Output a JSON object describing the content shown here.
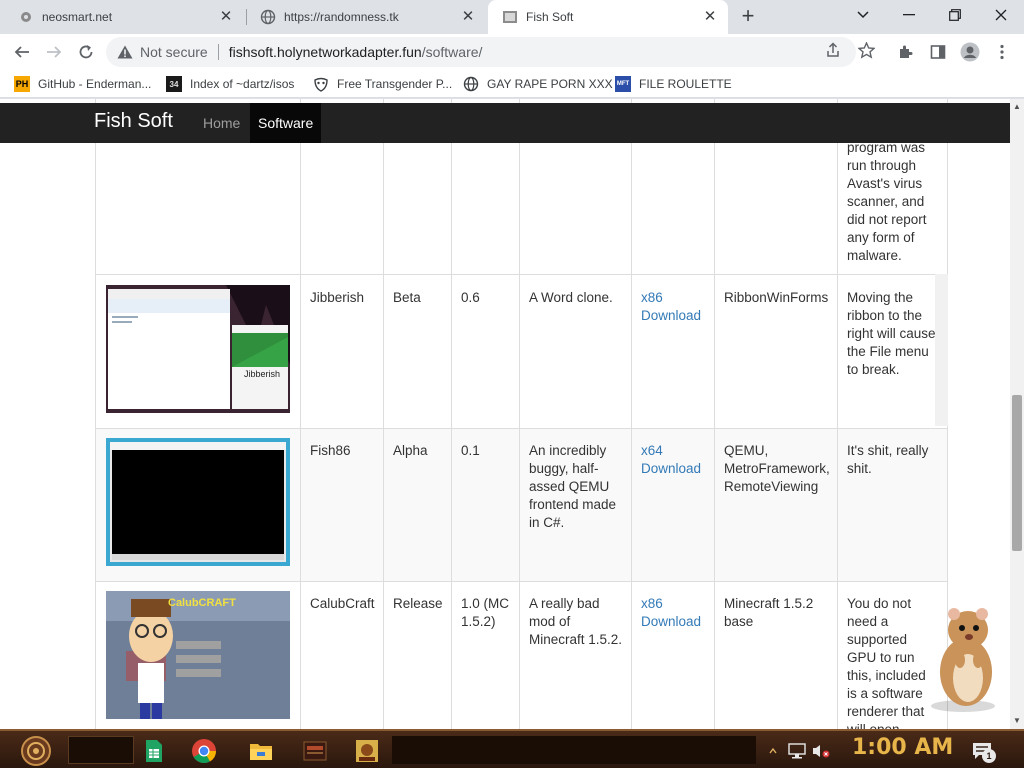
{
  "browser": {
    "tabs": [
      {
        "title": "neosmart.net",
        "icon": "gear-favicon"
      },
      {
        "title": "https://randomness.tk",
        "icon": "globe-icon"
      },
      {
        "title": "Fish Soft",
        "icon": "page-favicon",
        "active": true
      }
    ],
    "address": {
      "security_label": "Not secure",
      "host": "fishsoft.holynetworkadapter.fun",
      "path": "/software/"
    },
    "bookmarks": [
      {
        "label": "GitHub - Enderman...",
        "icon": "ph-favicon",
        "icon_text": "PH"
      },
      {
        "label": "Index of ~dartz/isos",
        "icon": "number-favicon",
        "icon_text": "34"
      },
      {
        "label": "Free Transgender P...",
        "icon": "mask-favicon",
        "icon_text": ""
      },
      {
        "label": "GAY RAPE PORN XXX",
        "icon": "globe-icon",
        "icon_text": ""
      },
      {
        "label": "FILE ROULETTE",
        "icon": "mft-favicon",
        "icon_text": "MFT"
      }
    ]
  },
  "site": {
    "brand": "Fish Soft",
    "nav": [
      {
        "label": "Home",
        "active": false
      },
      {
        "label": "Software",
        "active": true
      }
    ]
  },
  "table": {
    "partial_row_notes": "program was run through Avast's virus scanner, and did not report any form of malware.",
    "rows": [
      {
        "name": "Jibberish",
        "stage": "Beta",
        "version": "0.6",
        "description": "A Word clone.",
        "arch": "x86",
        "download": "Download",
        "built_with": "RibbonWinForms",
        "notes": "Moving the ribbon to the right will cause the File menu to break.",
        "shot_caption": "Jibberish"
      },
      {
        "name": "Fish86",
        "stage": "Alpha",
        "version": "0.1",
        "description": "An incredibly buggy, half-assed QEMU frontend made in C#.",
        "arch": "x64",
        "download": "Download",
        "built_with": "QEMU, MetroFramework, RemoteViewing",
        "notes": "It's shit, really shit.",
        "shot_caption": ""
      },
      {
        "name": "CalubCraft",
        "stage": "Release",
        "version": "1.0 (MC 1.5.2)",
        "description": "A really bad mod of Minecraft 1.5.2.",
        "arch": "x86",
        "download": "Download",
        "built_with": "Minecraft 1.5.2 base",
        "notes": "You do not need a supported GPU to run this, included is a software renderer that will open",
        "shot_caption": "CalubCRAFT"
      }
    ]
  },
  "taskbar": {
    "clock": "1:00 AM",
    "notification_count": "1"
  },
  "colors": {
    "navbar": "#222222",
    "link": "#337ab7",
    "clock": "#e8b54a"
  }
}
